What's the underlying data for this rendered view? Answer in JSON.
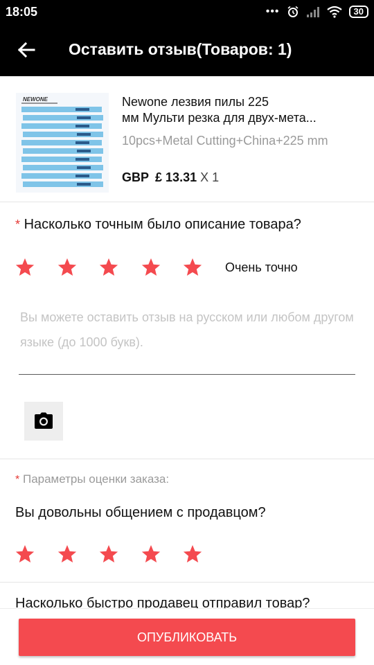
{
  "status_bar": {
    "time": "18:05",
    "icons": [
      "more-dots-icon",
      "alarm-icon",
      "signal-icon",
      "wifi-icon"
    ],
    "battery": "30"
  },
  "app_bar": {
    "back_icon": "arrow-back-icon",
    "title": "Оставить отзыв(Товаров: 1)"
  },
  "product": {
    "name_line1": "Newone лезвия пилы 225",
    "name_line2": "мм Мульти резка для двух-мета...",
    "variant": "10pcs+Metal Cutting+China+225 mm",
    "currency": "GBP",
    "price": "£ 13.31",
    "quantity": "X 1",
    "thumb_brand": "NEWONE"
  },
  "rating": {
    "required_mark": "*",
    "question": "Насколько точным было описание товара?",
    "stars_filled": 5,
    "stars_total": 5,
    "label": "Очень точно"
  },
  "review": {
    "value": "",
    "placeholder": "Вы можете оставить отзыв на русском или любом другом языке (до 1000 букв)."
  },
  "photo": {
    "icon": "camera-icon"
  },
  "params": {
    "required_mark": "*",
    "label": "Параметры оценки заказа:",
    "communication_question": "Вы довольны общением с продавцом?",
    "communication_stars": 5,
    "shipping_question": "Насколько быстро продавец отправил товар?"
  },
  "footer": {
    "publish_label": "ОПУБЛИКОВАТЬ"
  },
  "colors": {
    "accent": "#f44a4f",
    "star": "#f44a4f",
    "app_bar": "#000000",
    "placeholder": "#c4c4c4"
  }
}
